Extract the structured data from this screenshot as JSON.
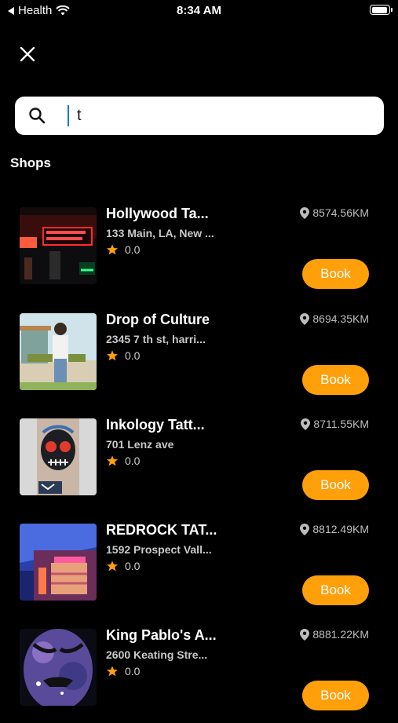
{
  "status_bar": {
    "back_app": "Health",
    "time": "8:34 AM"
  },
  "search": {
    "value": "t"
  },
  "section_title": "Shops",
  "shops": [
    {
      "name": "Hollywood Ta...",
      "address": "133 Main, LA, New ...",
      "rating": "0.0",
      "distance": "8574.56KM",
      "book_label": "Book"
    },
    {
      "name": "Drop of Culture",
      "address": "2345 7 th st, harri...",
      "rating": "0.0",
      "distance": "8694.35KM",
      "book_label": "Book"
    },
    {
      "name": "Inkology Tatt...",
      "address": "701 Lenz ave",
      "rating": "0.0",
      "distance": "8711.55KM",
      "book_label": "Book"
    },
    {
      "name": "REDROCK TAT...",
      "address": "1592 Prospect Vall...",
      "rating": "0.0",
      "distance": "8812.49KM",
      "book_label": "Book"
    },
    {
      "name": "King Pablo's A...",
      "address": "2600 Keating Stre...",
      "rating": "0.0",
      "distance": "8881.22KM",
      "book_label": "Book"
    }
  ],
  "colors": {
    "accent": "#ff9f0a",
    "star": "#ff9f0a",
    "background": "#000000"
  }
}
